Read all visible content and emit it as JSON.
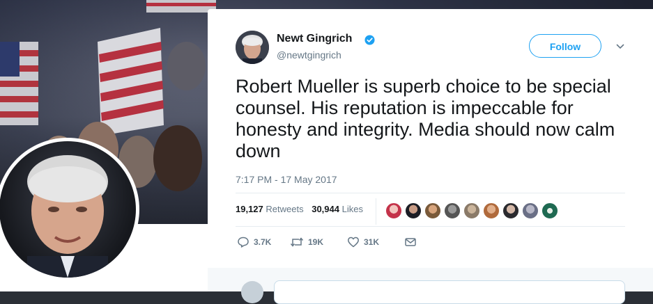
{
  "tweet": {
    "author_name": "Newt Gingrich",
    "author_handle": "@newtgingrich",
    "follow_label": "Follow",
    "text": "Robert Mueller is superb choice to be special counsel. His reputation is impeccable for honesty and integrity. Media should now calm down",
    "timestamp": "7:17 PM - 17 May 2017",
    "retweets_count": "19,127",
    "retweets_label": "Retweets",
    "likes_count": "30,944",
    "likes_label": "Likes",
    "replies_action_count": "3.7K",
    "retweets_action_count": "19K",
    "likes_action_count": "31K"
  },
  "colors": {
    "accent": "#1da1f2",
    "text_primary": "#14171a",
    "text_secondary": "#657786",
    "divider": "#e6ecf0"
  },
  "icons": {
    "verified": "verified-badge-icon",
    "caret": "chevron-down-icon",
    "reply": "reply-icon",
    "retweet": "retweet-icon",
    "like": "heart-icon",
    "dm": "envelope-icon"
  },
  "likers_count_shown": 9
}
